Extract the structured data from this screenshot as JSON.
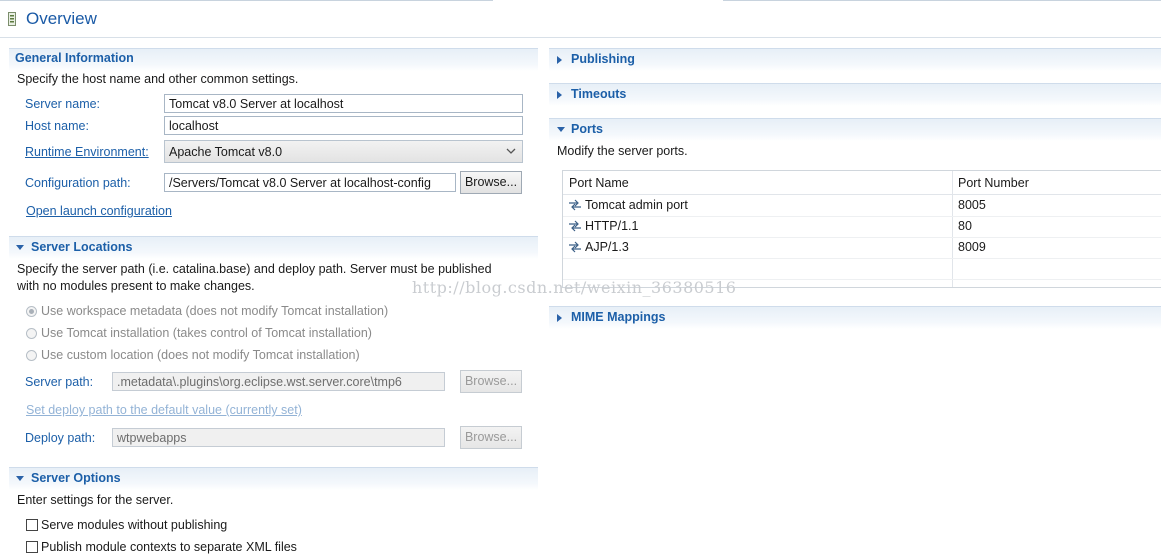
{
  "page": {
    "title": "Overview"
  },
  "general": {
    "title": "General Information",
    "description": "Specify the host name and other common settings.",
    "server_name_label": "Server name:",
    "server_name_value": "Tomcat v8.0 Server at localhost",
    "host_name_label": "Host name:",
    "host_name_value": "localhost",
    "runtime_label": "Runtime Environment:",
    "runtime_value": "Apache Tomcat v8.0",
    "config_label": "Configuration path:",
    "config_value": "/Servers/Tomcat v8.0 Server at localhost-config",
    "browse_label": "Browse...",
    "open_launch_label": "Open launch configuration"
  },
  "locations": {
    "title": "Server Locations",
    "description_line1": "Specify the server path (i.e. catalina.base) and deploy path. Server must be published",
    "description_line2": "with no modules present to make changes.",
    "option_workspace": "Use workspace metadata (does not modify Tomcat installation)",
    "option_tomcat": "Use Tomcat installation (takes control of Tomcat installation)",
    "option_custom": "Use custom location (does not modify Tomcat installation)",
    "server_path_label": "Server path:",
    "server_path_value": ".metadata\\.plugins\\org.eclipse.wst.server.core\\tmp6",
    "browse_label": "Browse...",
    "set_deploy_label": "Set deploy path to the default value (currently set)",
    "deploy_path_label": "Deploy path:",
    "deploy_path_value": "wtpwebapps",
    "browse2_label": "Browse..."
  },
  "options": {
    "title": "Server Options",
    "description": "Enter settings for the server.",
    "serve_modules_label": "Serve modules without publishing",
    "publish_contexts_label": "Publish module contexts to separate XML files"
  },
  "publishing": {
    "title": "Publishing"
  },
  "timeouts": {
    "title": "Timeouts"
  },
  "ports": {
    "title": "Ports",
    "description": "Modify the server ports.",
    "columns": [
      "Port Name",
      "Port Number"
    ],
    "rows": [
      {
        "name": "Tomcat admin port",
        "number": "8005"
      },
      {
        "name": "HTTP/1.1",
        "number": "80"
      },
      {
        "name": "AJP/1.3",
        "number": "8009"
      }
    ]
  },
  "mime": {
    "title": "MIME Mappings"
  },
  "watermark": "http://blog.csdn.net/weixin_36380516",
  "colors": {
    "accent": "#1c5fa8",
    "band": "#e7eff7"
  }
}
